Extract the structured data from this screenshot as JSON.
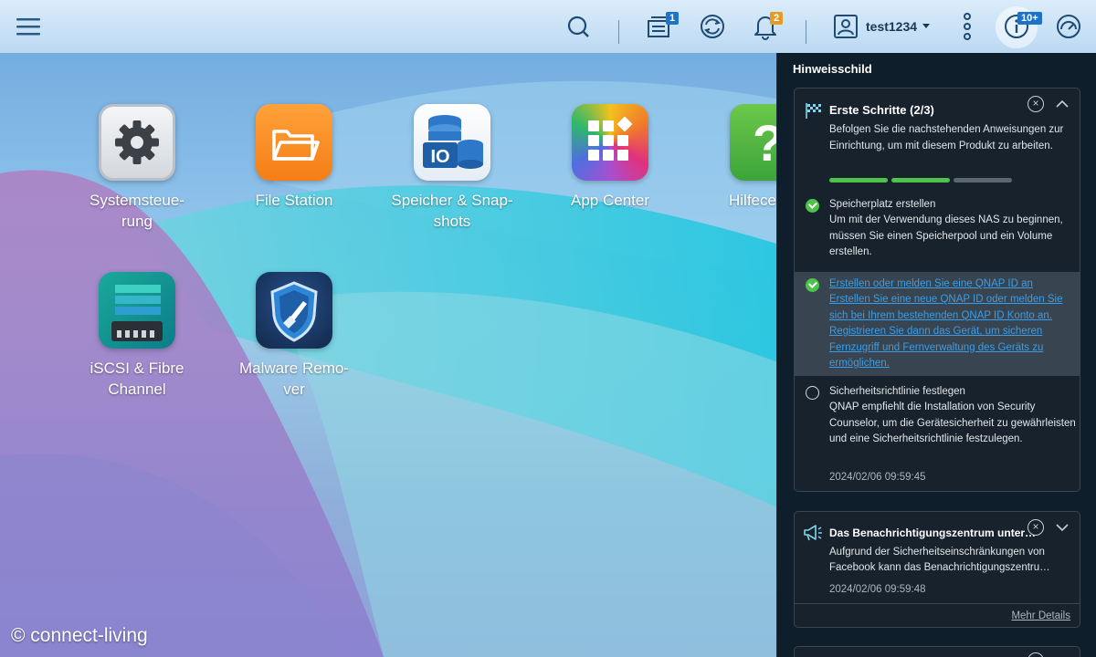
{
  "topbar": {
    "user_name": "test1234",
    "task_badge": "1",
    "notification_badge": "2",
    "info_badge": "10+",
    "colors": {
      "task_badge": "#1e73c8",
      "notification_badge": "#e89a26",
      "info_badge": "#1e73c8"
    }
  },
  "apps": [
    {
      "label": "Systemsteue-\nrung",
      "icon": "gear-icon"
    },
    {
      "label": "File Station",
      "icon": "folder-icon"
    },
    {
      "label": "Speicher & Snap-\nshots",
      "icon": "storage-icon"
    },
    {
      "label": "App Center",
      "icon": "app-grid-icon"
    },
    {
      "label": "Hilfece",
      "icon": "help-icon"
    },
    {
      "label": "iSCSI & Fibre\nChannel",
      "icon": "server-icon"
    },
    {
      "label": "Malware Remo-\nver",
      "icon": "shield-icon"
    }
  ],
  "watermark": "© connect-living",
  "panel": {
    "title": "Hinweisschild",
    "card1": {
      "title": "Erste Schritte (2/3)",
      "description": "Befolgen Sie die nachstehenden Anweisungen zur Einrichtung, um mit diesem Produkt zu arbeiten.",
      "progress_done": 2,
      "progress_total": 3,
      "steps": [
        {
          "title": "Speicherplatz erstellen",
          "body": "Um mit der Verwendung dieses NAS zu beginnen, müssen Sie einen Speicherpool und ein Volume erstellen.",
          "done": true
        },
        {
          "title": "Erstellen oder melden Sie eine QNAP ID an",
          "body": "Erstellen Sie eine neue QNAP ID oder melden Sie sich bei Ihrem bestehenden QNAP ID Konto an. Registrieren Sie dann das Gerät, um sicheren Fernzugriff und Fernverwaltung des Geräts zu ermöglichen.",
          "done": true
        },
        {
          "title": "Sicherheitsrichtlinie festlegen",
          "body": "QNAP empfiehlt die Installation von Security Counselor, um die Gerätesicherheit zu gewährleisten und eine Sicherheitsrichtlinie festzulegen.",
          "done": false
        }
      ],
      "timestamp": "2024/02/06 09:59:45"
    },
    "card2": {
      "title": "Das Benachrichtigungszentrum unter…",
      "body_line1": "Aufgrund der Sicherheitseinschränkungen von",
      "body_line2": "Facebook kann das Benachrichtigungszentru…",
      "timestamp": "2024/02/06 09:59:48",
      "more_link": "Mehr Details"
    }
  }
}
